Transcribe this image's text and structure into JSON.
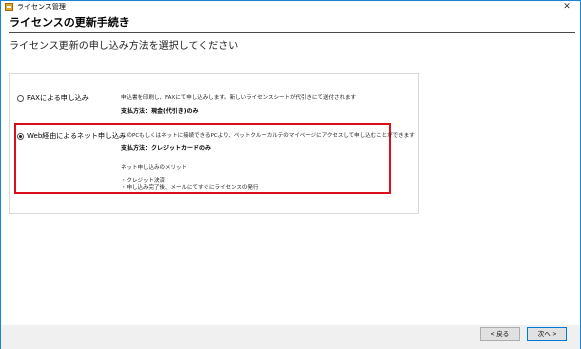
{
  "window": {
    "title": "ライセンス管理",
    "close_glyph": "✕"
  },
  "page": {
    "title": "ライセンスの更新手続き",
    "subtitle": "ライセンス更新の申し込み方法を選択してください"
  },
  "options": [
    {
      "label": "FAXによる申し込み",
      "selected": false,
      "description": "申込書を印刷し、FAXにて申し込みします。新しいライセンスシートが代引きにて送付されます",
      "payment": "支払方法：現金(代引き)のみ"
    },
    {
      "label": "Web経由によるネット申し込み",
      "selected": true,
      "description": "このPCもしくはネットに接続できるPCより、ペットクルーカルテのマイページにアクセスして申し込むことができます",
      "payment": "支払方法：クレジットカードのみ",
      "merits_title": "ネット申し込みのメリット",
      "merits": [
        "・クレジット決済",
        "・申し込み完了後、メールにてすぐにライセンスの発行"
      ]
    }
  ],
  "footer": {
    "back_label": "< 戻る",
    "next_label": "次へ >"
  },
  "colors": {
    "highlight": "#d9101a",
    "window_border": "#1883d7"
  },
  "icons": {
    "app": "app-license-icon",
    "close": "close-icon"
  }
}
